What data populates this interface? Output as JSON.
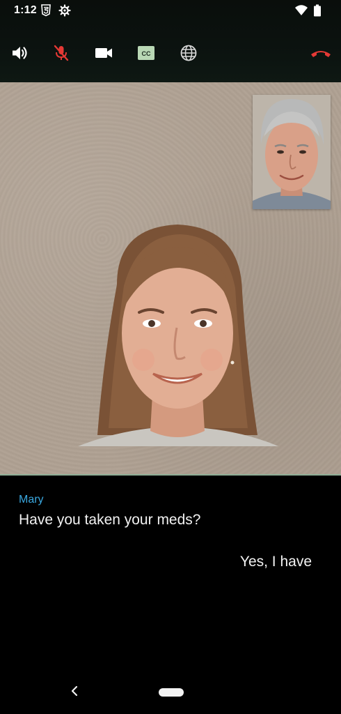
{
  "status_bar": {
    "time": "1:12",
    "icons": [
      "html5-icon",
      "settings-gear-icon",
      "wifi-icon",
      "battery-icon"
    ]
  },
  "toolbar": {
    "buttons": [
      {
        "name": "speaker",
        "icon": "volume-up-icon"
      },
      {
        "name": "microphone",
        "icon": "mic-off-icon",
        "state": "muted"
      },
      {
        "name": "camera",
        "icon": "videocam-icon"
      },
      {
        "name": "closed-captions",
        "icon": "cc-icon"
      },
      {
        "name": "language",
        "icon": "globe-icon"
      },
      {
        "name": "end-call",
        "icon": "hang-up-icon"
      }
    ]
  },
  "captions": {
    "remote_speaker": "Mary",
    "remote_text": "Have you taken your meds?",
    "self_text": "Yes, I have"
  },
  "navigation": {
    "icons": [
      "back-chevron-icon",
      "home-pill-icon"
    ]
  },
  "colors": {
    "speaker_name": "#3aa8e0",
    "end_call": "#e53935",
    "mic_muted": "#e53935",
    "cc_badge": "#b9d8b5",
    "caption_text": "#f2f2f2"
  }
}
